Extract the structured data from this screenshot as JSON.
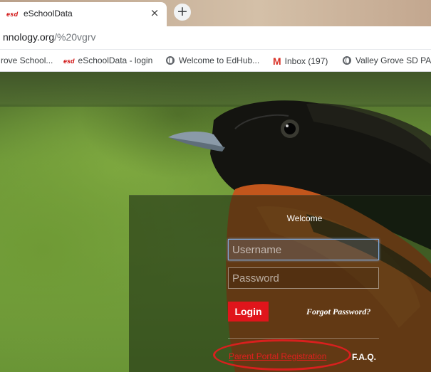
{
  "browser": {
    "tab": {
      "favicon_text": "esd",
      "title": "eSchoolData",
      "close_glyph": "×"
    },
    "new_tab_glyph": "+",
    "address": {
      "host": "nnology.org",
      "path": "/%20vgrv"
    },
    "bookmarks": [
      {
        "label": "rove School...",
        "icon": "none"
      },
      {
        "label": "eSchoolData - login",
        "icon": "esd-icon",
        "icon_text": "esd"
      },
      {
        "label": "Welcome to EdHub...",
        "icon": "globe-icon"
      },
      {
        "label": "Inbox (197)",
        "icon": "gmail-icon",
        "icon_text": "M"
      },
      {
        "label": "Valley Grove SD PA...",
        "icon": "globe-icon"
      }
    ]
  },
  "login": {
    "welcome": "Welcome",
    "username_placeholder": "Username",
    "password_placeholder": "Password",
    "login_label": "Login",
    "forgot_label": "Forgot Password?",
    "registration_label": "Parent Portal Registration",
    "faq_label": "F.A.Q."
  },
  "colors": {
    "accent_red": "#e0151b",
    "annotation_red": "#d8201e",
    "brand_red": "#d01010"
  }
}
